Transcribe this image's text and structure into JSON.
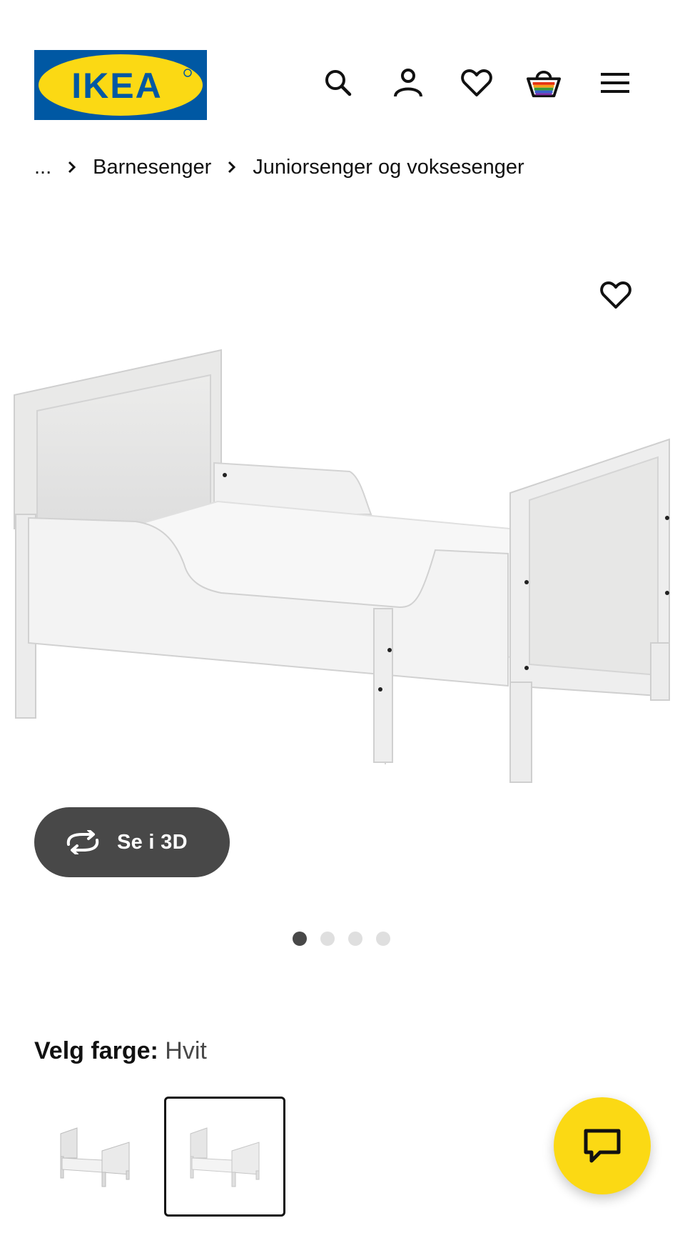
{
  "header": {
    "logo_text": "IKEA",
    "icons": [
      "search-icon",
      "account-icon",
      "heart-icon",
      "basket-icon",
      "menu-icon"
    ]
  },
  "breadcrumb": {
    "ellipsis": "...",
    "items": [
      "Barnesenger",
      "Juniorsenger og voksesenger"
    ]
  },
  "product": {
    "view_3d_label": "Se i 3D",
    "image_count": 4,
    "active_image": 1
  },
  "color_selection": {
    "label": "Velg farge:",
    "value": "Hvit",
    "swatch_count": 2,
    "selected_swatch": 2
  },
  "colors": {
    "ikea_blue": "#0058a3",
    "ikea_yellow": "#fbd914",
    "dark_grey": "#484848",
    "dot_inactive": "#dfdfdf"
  }
}
